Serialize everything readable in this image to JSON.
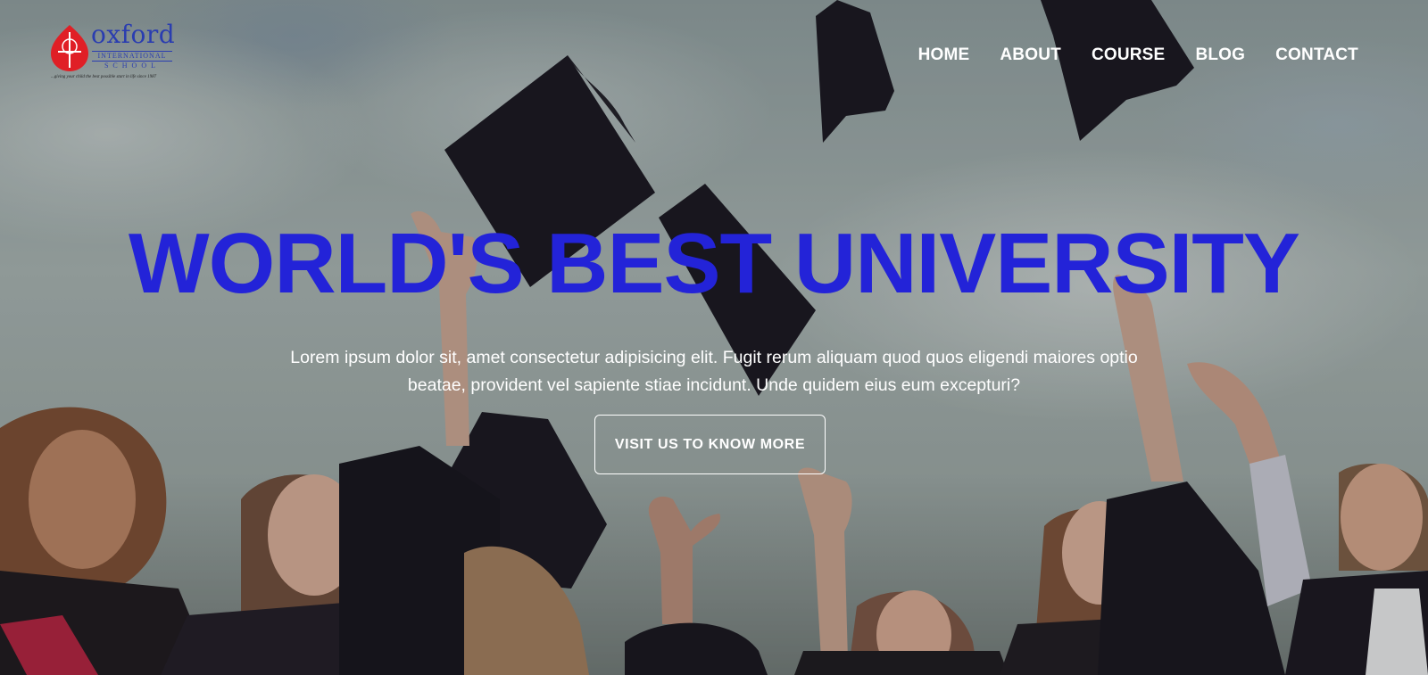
{
  "logo": {
    "word": "oxford",
    "line1": "INTERNATIONAL",
    "line2": "SCHOOL",
    "emblem_letters": "OIS",
    "tagline": "...giving your child the best possible start in life since 1987",
    "colors": {
      "emblem": "#e01f26",
      "text": "#2a3db0"
    }
  },
  "nav": {
    "items": [
      {
        "label": "HOME"
      },
      {
        "label": "ABOUT"
      },
      {
        "label": "COURSE"
      },
      {
        "label": "BLOG"
      },
      {
        "label": "CONTACT"
      }
    ]
  },
  "hero": {
    "title": "WORLD'S BEST UNIVERSITY",
    "description": "Lorem ipsum dolor sit, amet consectetur adipisicing elit. Fugit rerum aliquam quod quos eligendi maiores optio beatae, provident vel sapiente stiae incidunt. Unde quidem eius eum excepturi?",
    "cta_label": "VISIT US TO KNOW MORE",
    "background": "graduates-throwing-caps-photo",
    "colors": {
      "title": "#2323d8",
      "text": "#ffffff"
    }
  }
}
